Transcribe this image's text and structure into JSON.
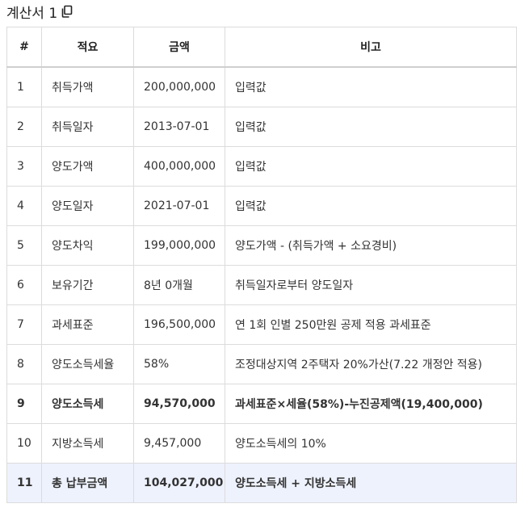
{
  "title": "계산서 1",
  "columns": [
    "#",
    "적요",
    "금액",
    "비고"
  ],
  "rows": [
    {
      "num": "1",
      "item": "취득가액",
      "amount": "200,000,000",
      "note": "입력값"
    },
    {
      "num": "2",
      "item": "취득일자",
      "amount": "2013-07-01",
      "note": "입력값"
    },
    {
      "num": "3",
      "item": "양도가액",
      "amount": "400,000,000",
      "note": "입력값"
    },
    {
      "num": "4",
      "item": "양도일자",
      "amount": "2021-07-01",
      "note": "입력값"
    },
    {
      "num": "5",
      "item": "양도차익",
      "amount": "199,000,000",
      "note": "양도가액 - (취득가액 + 소요경비)"
    },
    {
      "num": "6",
      "item": "보유기간",
      "amount": "8년 0개월",
      "note": "취득일자로부터 양도일자"
    },
    {
      "num": "7",
      "item": "과세표준",
      "amount": "196,500,000",
      "note": "연 1회 인별 250만원 공제 적용 과세표준"
    },
    {
      "num": "8",
      "item": "양도소득세율",
      "amount": "58%",
      "note": "조정대상지역 2주택자 20%가산(7.22 개정안 적용)"
    },
    {
      "num": "9",
      "item": "양도소득세",
      "amount": "94,570,000",
      "note": "과세표준×세율(58%)-누진공제액(19,400,000)"
    },
    {
      "num": "10",
      "item": "지방소득세",
      "amount": "9,457,000",
      "note": "양도소득세의 10%"
    },
    {
      "num": "11",
      "item": "총 납부금액",
      "amount": "104,027,000",
      "note": "양도소득세 + 지방소득세"
    }
  ],
  "icons": {
    "copy": "copy-icon"
  },
  "colors": {
    "highlight_row": "#eef2fd",
    "border": "#dcdcdc"
  }
}
